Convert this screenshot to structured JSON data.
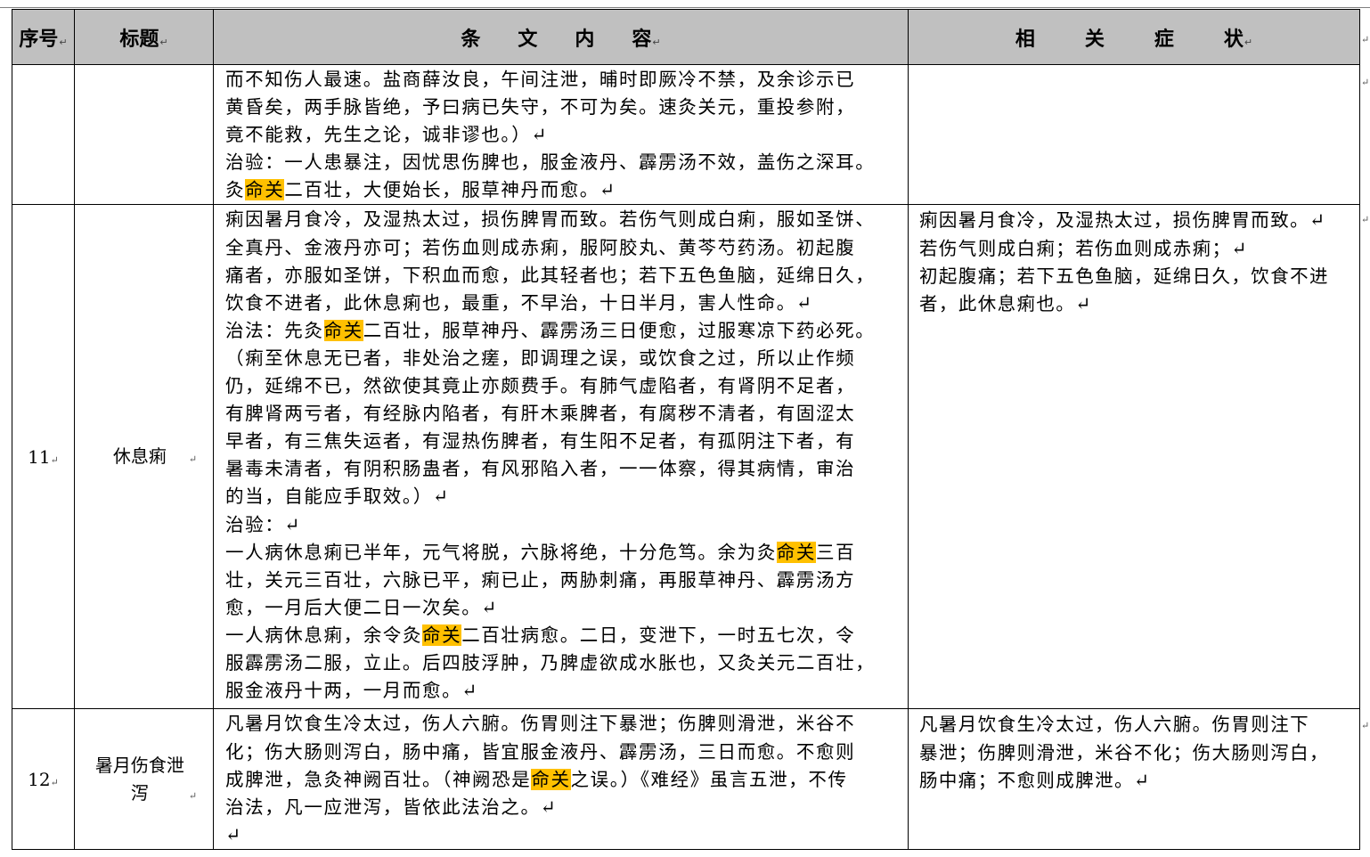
{
  "mark": "↵",
  "header": {
    "col_num": "序号",
    "col_title": "标题",
    "col_content": "条文内容",
    "col_symptoms": "相关症状"
  },
  "rows": [
    {
      "num": "",
      "title": "",
      "content_lines": [
        "而不知伤人最速。盐商薛汝良，午间注泄，晡时即厥冷不禁，及余诊示已",
        "黄昏矣，两手脉皆绝，予曰病已失守，不可为矣。速灸关元，重投参附，",
        "竟不能救，先生之论，诚非谬也。）↵",
        "治验：一人患暴注，因忧思伤脾也，服金液丹、霹雳汤不效，盖伤之深耳。",
        "灸[[命关]]二百壮，大便始长，服草神丹而愈。↵"
      ],
      "symptom_lines": []
    },
    {
      "num": "11",
      "title": "休息痢",
      "content_lines": [
        "痢因暑月食冷，及湿热太过，损伤脾胃而致。若伤气则成白痢，服如圣饼、",
        "全真丹、金液丹亦可；若伤血则成赤痢，服阿胶丸、黄芩芍药汤。初起腹",
        "痛者，亦服如圣饼，下积血而愈，此其轻者也；若下五色鱼脑，延绵日久，",
        "饮食不进者，此休息痢也，最重，不早治，十日半月，害人性命。↵",
        "治法：先灸[[命关]]二百壮，服草神丹、霹雳汤三日便愈，过服寒凉下药必死。",
        "（痢至休息无已者，非处治之瘥，即调理之误，或饮食之过，所以止作频",
        "仍，延绵不已，然欲使其竟止亦颇费手。有肺气虚陷者，有肾阴不足者，",
        "有脾肾两亏者，有经脉内陷者，有肝木乘脾者，有腐秽不清者，有固涩太",
        "早者，有三焦失运者，有湿热伤脾者，有生阳不足者，有孤阴注下者，有",
        "暑毒未清者，有阴积肠蛊者，有风邪陷入者，一一体察，得其病情，审治",
        "的当，自能应手取效。）↵",
        "治验：↵",
        "一人病休息痢已半年，元气将脱，六脉将绝，十分危笃。余为灸[[命关]]三百",
        "壮，关元三百壮，六脉已平，痢已止，两胁刺痛，再服草神丹、霹雳汤方",
        "愈，一月后大便二日一次矣。↵",
        "一人病休息痢，余令灸[[命关]]二百壮病愈。二日，变泄下，一时五七次，令",
        "服霹雳汤二服，立止。后四肢浮肿，乃脾虚欲成水胀也，又灸关元二百壮，",
        "服金液丹十两，一月而愈。↵"
      ],
      "symptom_lines": [
        "痢因暑月食冷，及湿热太过，损伤脾胃而致。↵",
        "若伤气则成白痢；若伤血则成赤痢；↵",
        "初起腹痛；若下五色鱼脑，延绵日久，饮食不进",
        "者，此休息痢也。↵"
      ]
    },
    {
      "num": "12",
      "title": "暑月伤食泄泻",
      "content_lines": [
        "凡暑月饮食生冷太过，伤人六腑。伤胃则注下暴泄；伤脾则滑泄，米谷不",
        "化；伤大肠则泻白，肠中痛，皆宜服金液丹、霹雳汤，三日而愈。不愈则",
        "成脾泄，急灸神阙百壮。（神阙恐是[[命关]]之误。）《难经》虽言五泄，不传",
        "治法，凡一应泄泻，皆依此法治之。↵",
        "↵"
      ],
      "symptom_lines": [
        "凡暑月饮食生冷太过，伤人六腑。伤胃则注下",
        "暴泄；伤脾则滑泄，米谷不化；伤大肠则泻白，",
        "肠中痛；不愈则成脾泄。↵"
      ]
    }
  ],
  "colors": {
    "highlight": "#ffc000",
    "header_bg": "#c0c0c0"
  }
}
